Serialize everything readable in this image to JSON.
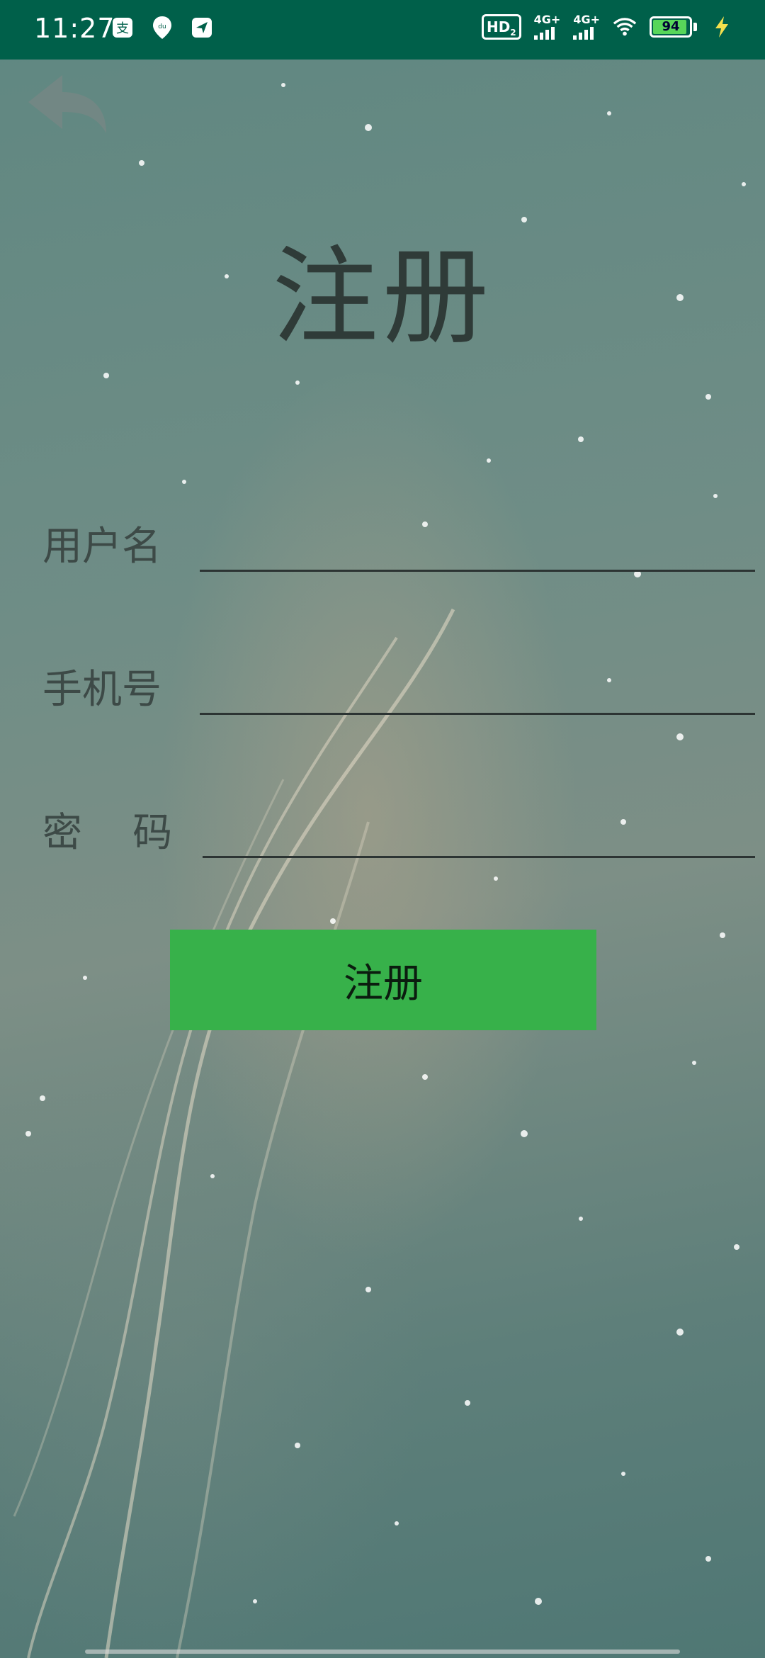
{
  "status_bar": {
    "time": "11:27",
    "left_icons": [
      "alipay-icon",
      "du-location-icon",
      "send-icon"
    ],
    "hd_label": "HD",
    "hd_sub": "2",
    "signal1_label": "4G+",
    "signal2_label": "4G+",
    "battery_level": "94",
    "bg_color": "#00604a"
  },
  "header": {
    "back_icon": "back-arrow-icon",
    "title": "注册"
  },
  "form": {
    "username_label": "用户名",
    "username_value": "",
    "phone_label": "手机号",
    "phone_value": "",
    "password_label": "密    码",
    "password_value": ""
  },
  "actions": {
    "register_label": "注册",
    "button_color": "#37b14a"
  }
}
